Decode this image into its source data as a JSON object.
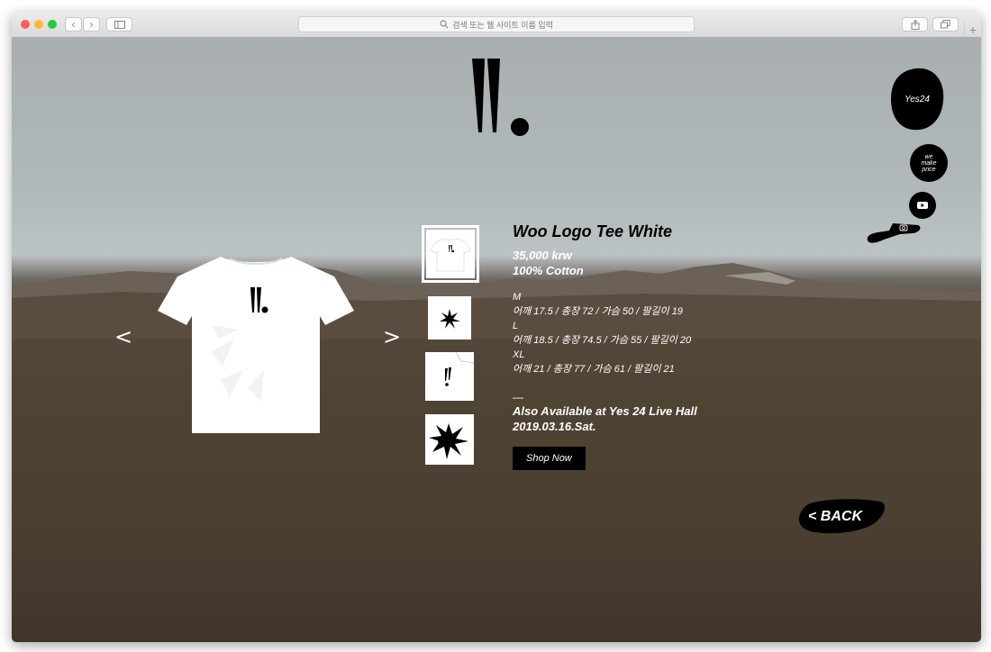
{
  "browser": {
    "address_placeholder": "검색 또는 웹 사이트 이름 입력",
    "search_icon": "search-icon",
    "new_tab_label": "+"
  },
  "side_nav": {
    "yes24_label": "Yes24",
    "we_make_price_label": "we make price",
    "youtube_icon": "youtube-icon",
    "instagram_icon": "instagram-icon"
  },
  "gallery": {
    "prev_label": "<",
    "next_label": ">"
  },
  "product": {
    "title": "Woo Logo Tee White",
    "price": "35,000 krw",
    "material": "100% Cotton",
    "sizes": [
      {
        "size": "M",
        "measurements": "어깨 17.5 / 총장 72 / 가슴 50 / 팔길이 19"
      },
      {
        "size": "L",
        "measurements": "어깨 18.5 / 총장 74.5 / 가슴 55 / 팔길이 20"
      },
      {
        "size": "XL",
        "measurements": "어깨 21 / 총장 77 / 가슴 61 / 팔길이 21"
      }
    ],
    "divider": "—",
    "availability_line1": "Also Available at Yes 24 Live Hall",
    "availability_line2": "2019.03.16.Sat.",
    "shop_label": "Shop Now"
  },
  "back": {
    "label": "<  BACK"
  },
  "colors": {
    "accent": "#000000",
    "text": "#ffffff"
  }
}
